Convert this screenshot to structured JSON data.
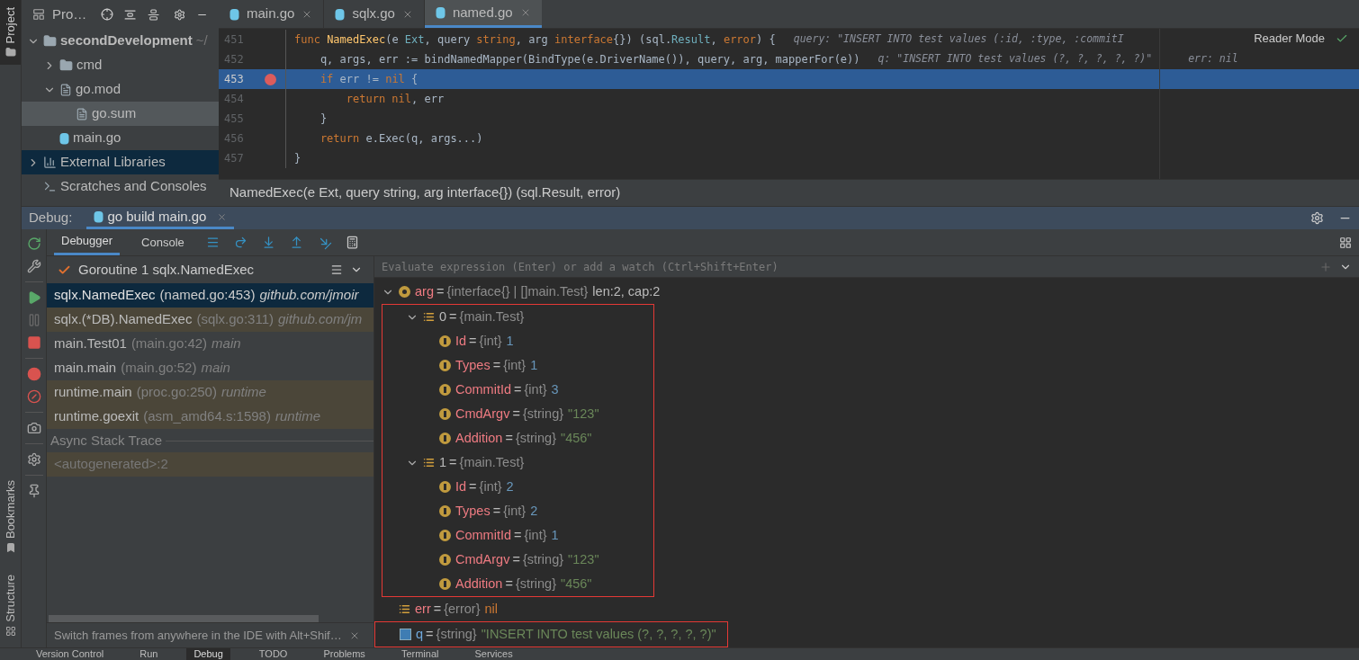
{
  "side_strip": {
    "top": [
      {
        "label": "Project",
        "selected": true
      }
    ],
    "bottom": [
      {
        "label": "Bookmarks"
      },
      {
        "label": "Structure"
      }
    ]
  },
  "project": {
    "title": "Pro…",
    "tree": [
      {
        "label": "secondDevelopment",
        "kind": "module",
        "hint": "~/",
        "expanded": true,
        "selected": false,
        "hovered": false,
        "children": [
          {
            "label": "cmd",
            "kind": "folder",
            "expanded": false,
            "selected": false,
            "hovered": false
          },
          {
            "label": "go.mod",
            "kind": "file",
            "expanded": true,
            "selected": false,
            "hovered": false,
            "children": [
              {
                "label": "go.sum",
                "kind": "file",
                "selected": false,
                "hovered": true
              }
            ]
          },
          {
            "label": "main.go",
            "kind": "gofile",
            "selected": false,
            "hovered": false
          }
        ]
      },
      {
        "label": "External Libraries",
        "kind": "library",
        "expanded": false,
        "selected": true,
        "hovered": false
      },
      {
        "label": "Scratches and Consoles",
        "kind": "scratch",
        "selected": false,
        "hovered": false
      }
    ]
  },
  "editor": {
    "tabs": [
      {
        "label": "main.go",
        "selected": false
      },
      {
        "label": "sqlx.go",
        "selected": false
      },
      {
        "label": "named.go",
        "selected": true
      }
    ],
    "reader_mode": "Reader Mode",
    "lines": [
      {
        "number": "451",
        "breakpoint": false,
        "current": false,
        "tokens": [
          {
            "t": "func ",
            "kind": "keyword"
          },
          {
            "t": "NamedExec",
            "kind": "function"
          },
          {
            "t": "(e ",
            "kind": "plain"
          },
          {
            "t": "Ext",
            "kind": "type"
          },
          {
            "t": ", query ",
            "kind": "plain"
          },
          {
            "t": "string",
            "kind": "keyword"
          },
          {
            "t": ", arg ",
            "kind": "plain"
          },
          {
            "t": "interface",
            "kind": "keyword"
          },
          {
            "t": "{}) (sql.",
            "kind": "plain"
          },
          {
            "t": "Result",
            "kind": "type"
          },
          {
            "t": ", ",
            "kind": "plain"
          },
          {
            "t": "error",
            "kind": "keyword"
          },
          {
            "t": ") {",
            "kind": "plain"
          }
        ],
        "hints": [
          "query: \"INSERT INTO test values (:id, :type, :commitI"
        ]
      },
      {
        "number": "452",
        "breakpoint": false,
        "current": false,
        "tokens": [
          {
            "t": "    q, args, err := bindNamedMapper(BindType(e.DriverName()), query, arg, mapperFor(e))",
            "kind": "plain"
          }
        ],
        "hints": [
          "q: \"INSERT INTO test values (?, ?, ?, ?, ?)\"",
          "err: nil"
        ]
      },
      {
        "number": "453",
        "breakpoint": true,
        "current": true,
        "tokens": [
          {
            "t": "    if",
            "kind": "keyword"
          },
          {
            "t": " err != ",
            "kind": "plain"
          },
          {
            "t": "nil",
            "kind": "keyword"
          },
          {
            "t": " {",
            "kind": "plain"
          }
        ]
      },
      {
        "number": "454",
        "breakpoint": false,
        "current": false,
        "tokens": [
          {
            "t": "        return nil",
            "kind": "keyword"
          },
          {
            "t": ", err",
            "kind": "plain"
          }
        ]
      },
      {
        "number": "455",
        "breakpoint": false,
        "current": false,
        "tokens": [
          {
            "t": "    }",
            "kind": "plain"
          }
        ]
      },
      {
        "number": "456",
        "breakpoint": false,
        "current": false,
        "tokens": [
          {
            "t": "    return",
            "kind": "keyword"
          },
          {
            "t": " e.Exec(q, args...)",
            "kind": "plain"
          }
        ]
      },
      {
        "number": "457",
        "breakpoint": false,
        "current": false,
        "tokens": [
          {
            "t": "}",
            "kind": "plain"
          }
        ]
      }
    ],
    "breadcrumb": "NamedExec(e Ext, query string, arg interface{}) (sql.Result, error)"
  },
  "debug": {
    "label": "Debug:",
    "session": {
      "label": "go build main.go",
      "selected": true
    },
    "subtabs": [
      {
        "label": "Debugger",
        "selected": true
      },
      {
        "label": "Console",
        "selected": false
      }
    ],
    "goroutine": "Goroutine 1 sqlx.NamedExec",
    "frames": [
      {
        "name": "sqlx.NamedExec",
        "location": "(named.go:453)",
        "package": "github.com/jmoir",
        "selected": true,
        "library": false
      },
      {
        "name": "sqlx.(*DB).NamedExec",
        "location": "(sqlx.go:311)",
        "package": "github.com/jm",
        "selected": false,
        "library": true
      },
      {
        "name": "main.Test01",
        "location": "(main.go:42)",
        "package": "main",
        "selected": false,
        "library": false
      },
      {
        "name": "main.main",
        "location": "(main.go:52)",
        "package": "main",
        "selected": false,
        "library": false
      },
      {
        "name": "runtime.main",
        "location": "(proc.go:250)",
        "package": "runtime",
        "selected": false,
        "library": true
      },
      {
        "name": "runtime.goexit",
        "location": "(asm_amd64.s:1598)",
        "package": "runtime",
        "selected": false,
        "library": true
      }
    ],
    "async_title": "Async Stack Trace",
    "async_frames": [
      {
        "name": "<autogenerated>:2",
        "library": true
      }
    ],
    "hint": "Switch frames from anywhere in the IDE with Alt+Shif…",
    "evaluate": {
      "placeholder": "Evaluate expression (Enter) or add a watch (Ctrl+Shift+Enter)"
    },
    "variables": [
      {
        "name": "arg",
        "eq": "=",
        "kind": "param",
        "type": "{interface{} | []main.Test}",
        "value": {
          "text": "len:2, cap:2",
          "kind": "plain"
        },
        "expanded": true,
        "boxed": false,
        "children_boxed": true,
        "children": [
          {
            "name": "0",
            "eq": "=",
            "kind": "element",
            "type": "{main.Test}",
            "expanded": true,
            "children": [
              {
                "name": "Id",
                "eq": "=",
                "kind": "field",
                "type": "{int}",
                "value": {
                  "text": "1",
                  "kind": "number"
                }
              },
              {
                "name": "Types",
                "eq": "=",
                "kind": "field",
                "type": "{int}",
                "value": {
                  "text": "1",
                  "kind": "number"
                }
              },
              {
                "name": "CommitId",
                "eq": "=",
                "kind": "field",
                "type": "{int}",
                "value": {
                  "text": "3",
                  "kind": "number"
                }
              },
              {
                "name": "CmdArgv",
                "eq": "=",
                "kind": "field",
                "type": "{string}",
                "value": {
                  "text": "\"123\"",
                  "kind": "string"
                }
              },
              {
                "name": "Addition",
                "eq": "=",
                "kind": "field",
                "type": "{string}",
                "value": {
                  "text": "\"456\"",
                  "kind": "string"
                }
              }
            ]
          },
          {
            "name": "1",
            "eq": "=",
            "kind": "element",
            "type": "{main.Test}",
            "expanded": true,
            "children": [
              {
                "name": "Id",
                "eq": "=",
                "kind": "field",
                "type": "{int}",
                "value": {
                  "text": "2",
                  "kind": "number"
                }
              },
              {
                "name": "Types",
                "eq": "=",
                "kind": "field",
                "type": "{int}",
                "value": {
                  "text": "2",
                  "kind": "number"
                }
              },
              {
                "name": "CommitId",
                "eq": "=",
                "kind": "field",
                "type": "{int}",
                "value": {
                  "text": "1",
                  "kind": "number"
                }
              },
              {
                "name": "CmdArgv",
                "eq": "=",
                "kind": "field",
                "type": "{string}",
                "value": {
                  "text": "\"123\"",
                  "kind": "string"
                }
              },
              {
                "name": "Addition",
                "eq": "=",
                "kind": "field",
                "type": "{string}",
                "value": {
                  "text": "\"456\"",
                  "kind": "string"
                }
              }
            ]
          }
        ]
      },
      {
        "name": "err",
        "eq": "=",
        "kind": "local",
        "type": "{error}",
        "value": {
          "text": "nil",
          "kind": "keyword"
        },
        "boxed": false
      },
      {
        "name": "q",
        "eq": "=",
        "kind": "string",
        "type": "{string}",
        "value": {
          "text": "\"INSERT INTO test values (?, ?, ?, ?, ?)\"",
          "kind": "string"
        },
        "boxed": true
      }
    ]
  },
  "bottom_tabs": [
    {
      "label": "Version Control",
      "selected": false
    },
    {
      "label": "Run",
      "selected": false
    },
    {
      "label": "Debug",
      "selected": true
    },
    {
      "label": "TODO",
      "selected": false
    },
    {
      "label": "Problems",
      "selected": false
    },
    {
      "label": "Terminal",
      "selected": false
    },
    {
      "label": "Services",
      "selected": false
    }
  ]
}
